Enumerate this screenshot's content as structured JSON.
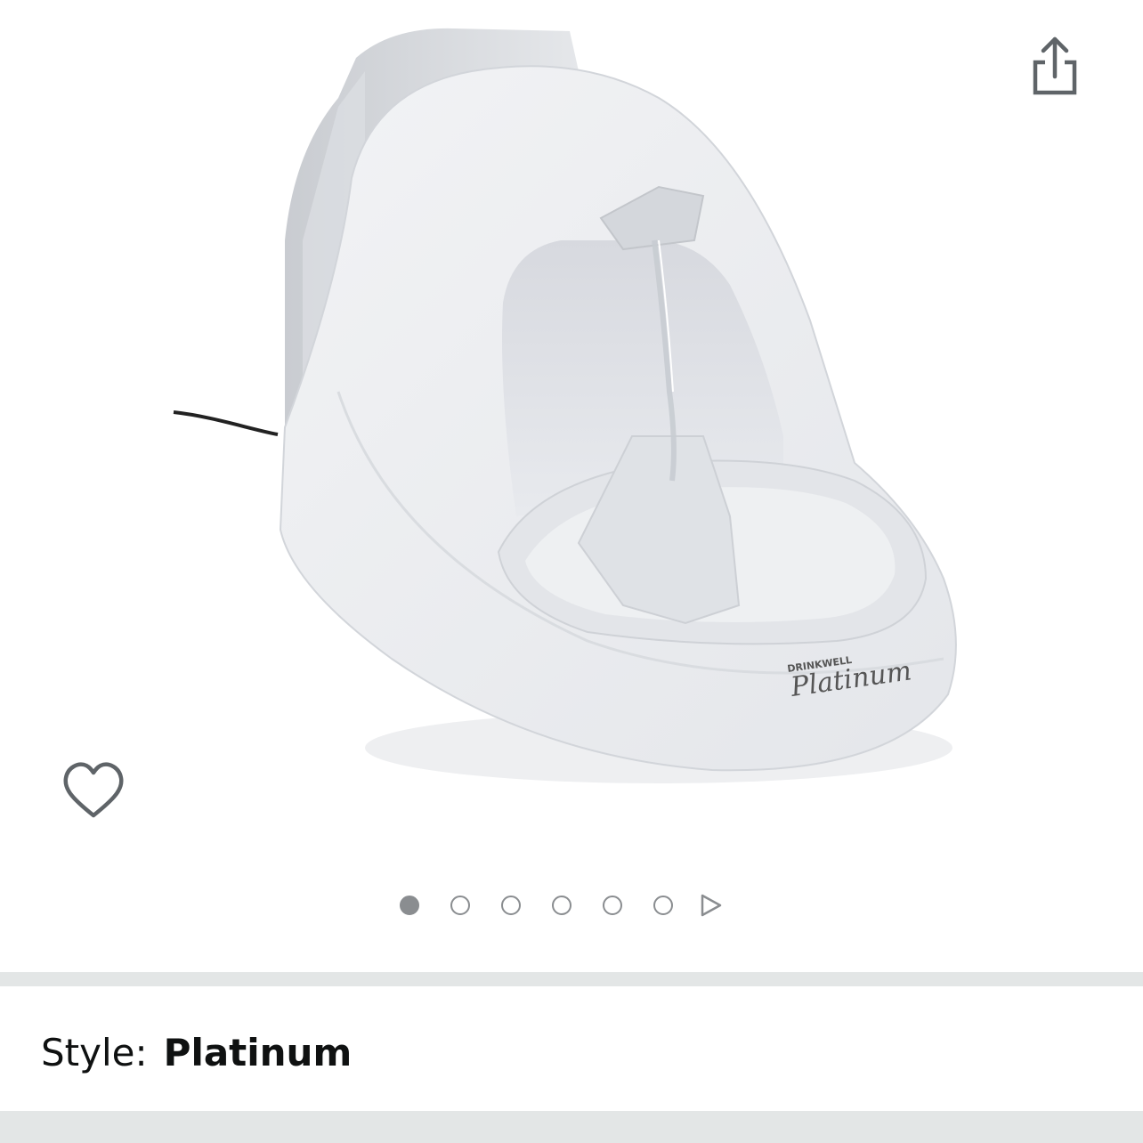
{
  "product": {
    "image_alt": "Drinkwell Platinum pet fountain",
    "brand_mark": "DRINKWELL",
    "model_mark": "Platinum"
  },
  "gallery": {
    "image_count": 6,
    "active_index": 0
  },
  "icons": {
    "share": "share-icon",
    "wishlist": "heart-outline-icon",
    "next": "play-triangle-icon"
  },
  "style": {
    "label": "Style:",
    "value": "Platinum"
  },
  "colors": {
    "icon_gray": "#8a8d90",
    "divider": "#e3e6e6",
    "text": "#0f1111"
  }
}
